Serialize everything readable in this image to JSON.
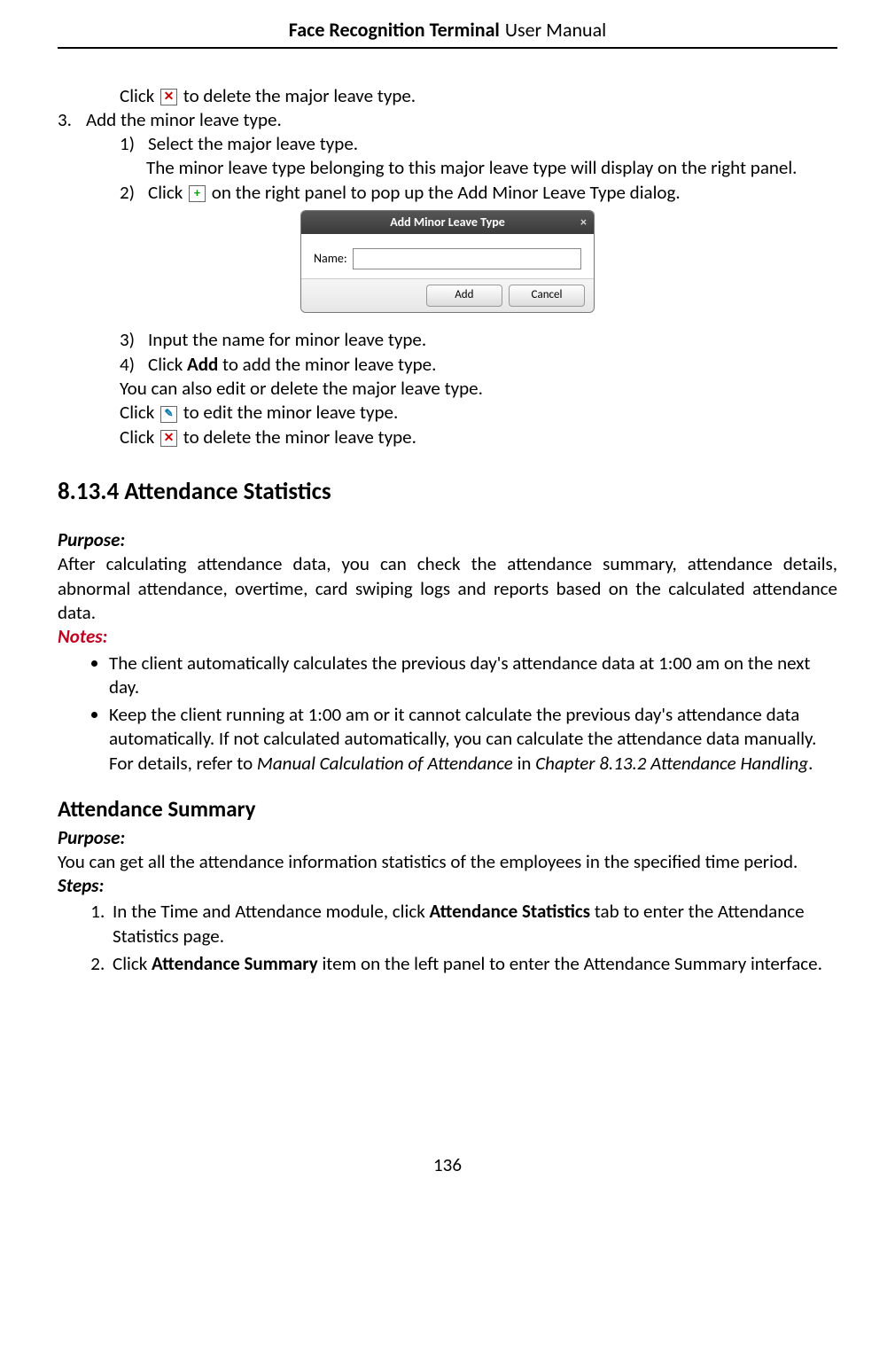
{
  "header": {
    "title_bold": "Face Recognition Terminal",
    "title_thin": "User Manual"
  },
  "top": {
    "click_delete_major": "to delete the major leave type.",
    "step3_num": "3.",
    "step3_text": "Add the minor leave type.",
    "s31_num": "1)",
    "s31_text": "Select the major leave type.",
    "s31_sub": "The minor leave type belonging to this major leave type will display on the right panel.",
    "s32_num": "2)",
    "s32_a": "Click",
    "s32_b": "on the right panel to pop up the Add Minor Leave Type dialog."
  },
  "dialog": {
    "title": "Add Minor Leave Type",
    "name_label": "Name:",
    "name_value": "",
    "add": "Add",
    "cancel": "Cancel"
  },
  "after_dialog": {
    "s33_num": "3)",
    "s33": "Input the name for minor leave type.",
    "s34_num": "4)",
    "s34_a": "Click ",
    "s34_bold": "Add",
    "s34_b": " to add the minor leave type.",
    "editdel_intro": "You can also edit or delete the major leave type.",
    "edit_a": "Click",
    "edit_b": "to edit the minor leave type.",
    "del_a": "Click",
    "del_b": "to delete the minor leave type."
  },
  "section": {
    "h2": "8.13.4 Attendance Statistics",
    "purpose_label": "Purpose:",
    "purpose_body": "After calculating attendance data, you can check the attendance summary, attendance details, abnormal attendance, overtime, card swiping logs and reports based on the calculated attendance data.",
    "notes_label": "Notes:",
    "note1": "The client automatically calculates the previous day's attendance data at 1:00 am on the next day.",
    "note2_a": "Keep the client running at 1:00 am or it cannot calculate the previous day's attendance data automatically. If not calculated automatically, you can calculate the attendance data manually. For details, refer to ",
    "note2_em1": "Manual Calculation of Attendance",
    "note2_b": " in ",
    "note2_em2": "Chapter 8.13.2 Attendance Handling",
    "note2_c": "."
  },
  "summary": {
    "h3": "Attendance Summary",
    "purpose_label": "Purpose:",
    "purpose_body": "You can get all the attendance information statistics of the employees in the specified time period.",
    "steps_label": "Steps:",
    "step1_a": "In the Time and Attendance module, click ",
    "step1_bold": "Attendance Statistics",
    "step1_b": " tab to enter the Attendance Statistics page.",
    "step2_a": "Click ",
    "step2_bold": "Attendance Summary",
    "step2_b": " item on the left panel to enter the Attendance Summary interface."
  },
  "page_number": "136"
}
